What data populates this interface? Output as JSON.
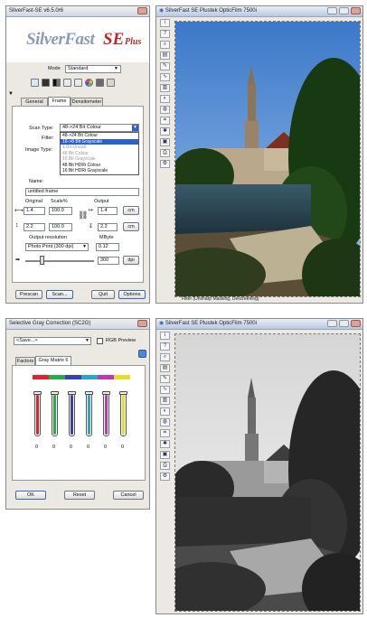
{
  "main_panel": {
    "title": "SilverFast-SE v6.5.0r6",
    "logo_main": "SilverFast",
    "logo_se": "SE",
    "logo_plus": "Plus",
    "mode_label": "Mode",
    "mode_value": "Standard",
    "tabs": [
      "General",
      "Frame",
      "Densitometer"
    ],
    "scan_type_label": "Scan Type:",
    "scan_type_value": "48->24 Bit Colour",
    "filter_label": "Filter:",
    "image_type_label": "Image Type:",
    "scan_type_options": [
      {
        "label": "48->24 Bit Colour",
        "state": "normal"
      },
      {
        "label": "16->8 Bit Grayscale",
        "state": "selected"
      },
      {
        "label": "1 Bit Lineart",
        "state": "disabled"
      },
      {
        "label": "48 Bit Colour",
        "state": "disabled"
      },
      {
        "label": "16 Bit Grayscale",
        "state": "disabled"
      },
      {
        "label": "48 Bit HDRi Colour",
        "state": "normal"
      },
      {
        "label": "16 Bit HDRi Grayscale",
        "state": "normal"
      }
    ],
    "name_label": "Name:",
    "name_value": "untitled frame",
    "col_original": "Original",
    "col_scale": "Scale%",
    "col_output": "Output",
    "width_original": "1.4",
    "width_scale": "100.0",
    "width_output": "1.4",
    "width_unit": "cm",
    "height_original": "2.2",
    "height_scale": "100.0",
    "height_output": "2.2",
    "height_unit": "cm",
    "output_resolution_label": "Output resolution",
    "output_resolution_value": "Photo Print (300 dpi)",
    "mbyte_label": "MByte",
    "mbyte_value": "0.12",
    "dpi_value": "300",
    "dpi_unit": "dpi",
    "buttons": [
      "Prescan",
      "Scan...",
      "Quit",
      "Options"
    ]
  },
  "preview_top": {
    "title": "SilverFast SE Plustek OpticFilm 7500i",
    "status": "Filter (Unsharp Masking, Descreening)"
  },
  "preview_bottom": {
    "title": "SilverFast SE Plustek OpticFilm 7500i"
  },
  "sgc_panel": {
    "title": "Selective Gray Correction (SC2G)",
    "preset_value": "<Save...>",
    "rgb_preview_label": "RGB Preview",
    "tabs": [
      "Factors",
      "Gray Matrix 6"
    ],
    "channel_values": [
      "0",
      "0",
      "0",
      "0",
      "0",
      "0"
    ],
    "channel_colors": [
      "#d8262c",
      "#2aa84a",
      "#3b3fb0",
      "#2aa7c4",
      "#b83bb5",
      "#e6dc2a"
    ],
    "buttons": [
      "OK",
      "Reset",
      "Cancel"
    ]
  },
  "toolbar_icons": [
    "info-icon",
    "question-icon",
    "loupe-icon",
    "levels-icon",
    "eyedropper-icon",
    "gradation-icon",
    "histogram-icon",
    "neg-fix-icon",
    "color-icon",
    "crop-icon",
    "grain-icon",
    "save-icon",
    "print-icon",
    "settings-icon"
  ]
}
